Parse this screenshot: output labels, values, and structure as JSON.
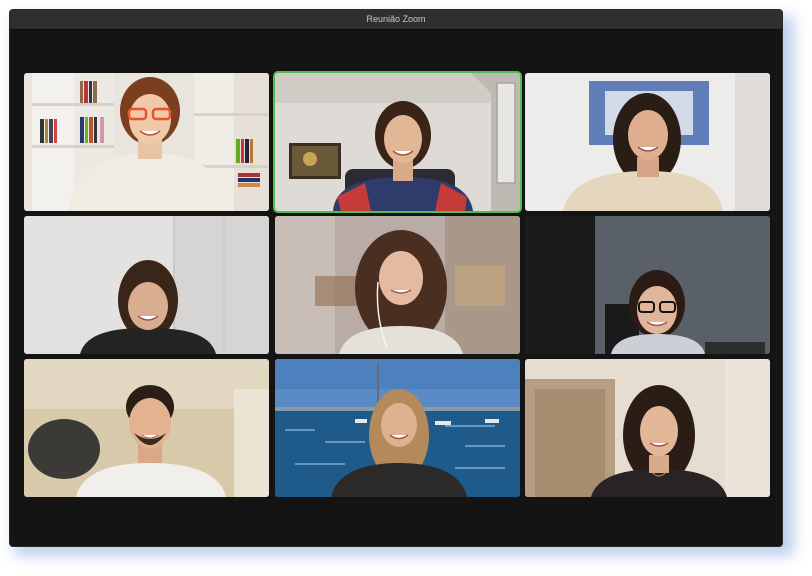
{
  "window": {
    "title": "Reunião Zoom"
  },
  "grid": {
    "active_speaker_index": 1,
    "participants": [
      {
        "icon": "participant-video",
        "bg": "#e7e2da"
      },
      {
        "icon": "participant-video",
        "bg": "#d9d7d2"
      },
      {
        "icon": "participant-video",
        "bg": "#eceae7"
      },
      {
        "icon": "participant-video",
        "bg": "#dcdad8"
      },
      {
        "icon": "participant-video",
        "bg": "#b9aca7"
      },
      {
        "icon": "participant-video",
        "bg": "#3d4145"
      },
      {
        "icon": "participant-video",
        "bg": "#d7c7a6"
      },
      {
        "icon": "participant-video",
        "bg": "#5f86b5"
      },
      {
        "icon": "participant-video",
        "bg": "#e4dccd"
      }
    ]
  }
}
